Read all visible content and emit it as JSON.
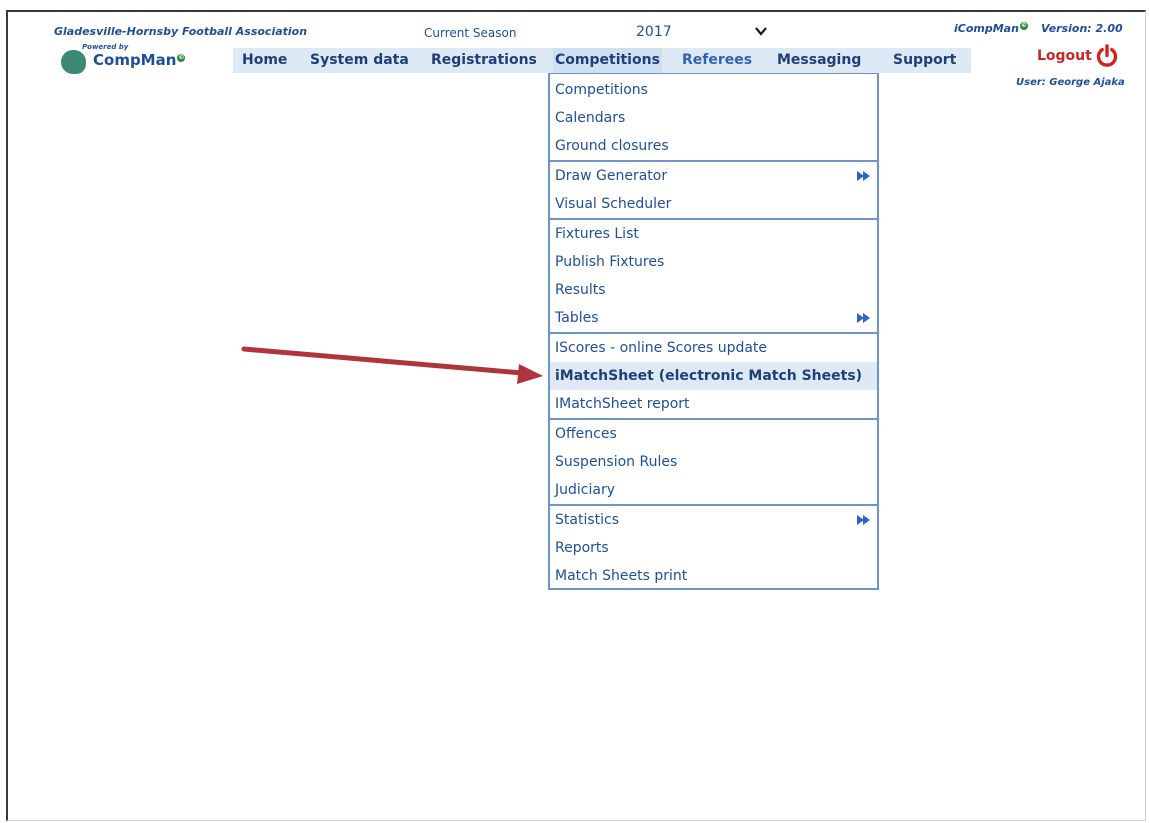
{
  "header": {
    "association": "Gladesville-Hornsby Football Association",
    "powered_by": "Powered by",
    "logo_text": "CompMan",
    "copyright_mark": "©",
    "season_label": "Current Season",
    "season_value": "2017",
    "icompman": "iCompMan",
    "version": "Version: 2.00",
    "logout_label": "Logout",
    "user": "User: George Ajaka"
  },
  "menu": {
    "items": [
      "Home",
      "System data",
      "Registrations",
      "Competitions",
      "Referees",
      "Messaging",
      "Support"
    ],
    "active": "Competitions"
  },
  "dropdown": {
    "items": [
      "Competitions",
      "Calendars",
      "Ground closures",
      "Draw Generator",
      "Visual Scheduler",
      "Fixtures List",
      "Publish Fixtures",
      "Results",
      "Tables",
      "IScores - online Scores update",
      "iMatchSheet (electronic Match Sheets)",
      "IMatchSheet report",
      "Offences",
      "Suspension Rules",
      "Judiciary",
      "Statistics",
      "Reports",
      "Match Sheets print"
    ],
    "highlighted": "iMatchSheet (electronic Match Sheets)"
  },
  "colors": {
    "brand_blue": "#1f4e9a",
    "menu_bar": "#dde9f5",
    "arrow": "#b0343c",
    "logout_red": "#c62828",
    "logo_green": "#3a8a74"
  },
  "icons": [
    "chevron-down-icon",
    "power-icon",
    "submenu-arrow-icon",
    "annotation-arrow-icon"
  ]
}
